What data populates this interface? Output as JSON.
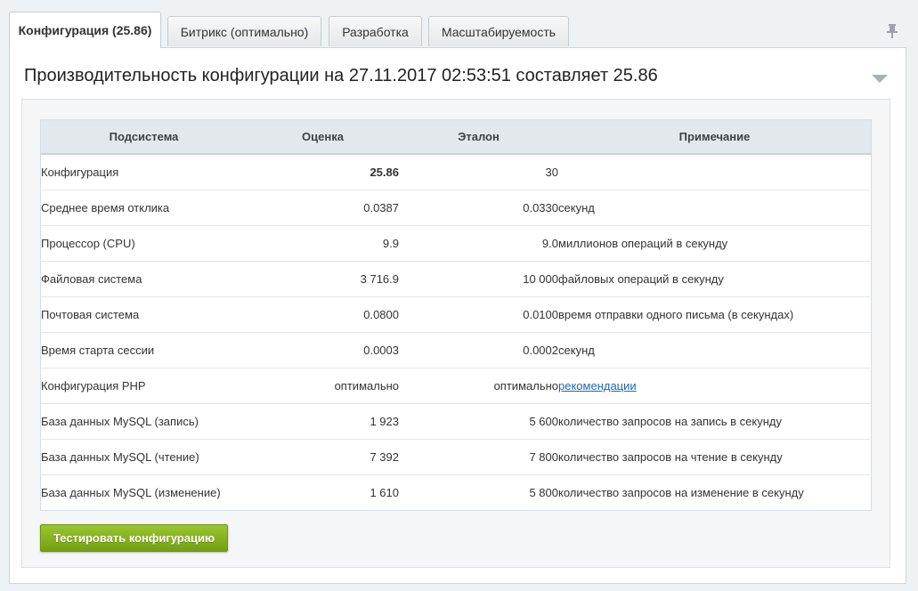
{
  "tabs": [
    {
      "label": "Конфигурация (25.86)",
      "active": true
    },
    {
      "label": "Битрикс (оптимально)",
      "active": false
    },
    {
      "label": "Разработка",
      "active": false
    },
    {
      "label": "Масштабируемость",
      "active": false
    }
  ],
  "icons": {
    "pin": "pin-icon",
    "collapse": "chevron-down-icon"
  },
  "panel": {
    "heading": "Производительность конфигурации на 27.11.2017 02:53:51 составляет 25.86"
  },
  "table": {
    "headers": [
      "Подсистема",
      "Оценка",
      "Эталон",
      "Примечание"
    ],
    "rows": [
      {
        "name": "Конфигурация",
        "score": "25.86",
        "reference": "30",
        "note": ""
      },
      {
        "name": "Среднее время отклика",
        "score": "0.0387",
        "reference": "0.0330",
        "note": "секунд"
      },
      {
        "name": "Процессор (CPU)",
        "score": "9.9",
        "reference": "9.0",
        "note": "миллионов операций в секунду"
      },
      {
        "name": "Файловая система",
        "score": "3 716.9",
        "reference": "10 000",
        "note": "файловых операций в секунду"
      },
      {
        "name": "Почтовая система",
        "score": "0.0800",
        "reference": "0.0100",
        "note": "время отправки одного письма (в секундах)"
      },
      {
        "name": "Время старта сессии",
        "score": "0.0003",
        "reference": "0.0002",
        "note": "секунд"
      },
      {
        "name": "Конфигурация PHP",
        "score": "оптимально",
        "reference": "оптимально",
        "note": "рекомендации",
        "note_is_link": true
      },
      {
        "name": "База данных MySQL (запись)",
        "score": "1 923",
        "reference": "5 600",
        "note": "количество запросов на запись в секунду"
      },
      {
        "name": "База данных MySQL (чтение)",
        "score": "7 392",
        "reference": "7 800",
        "note": "количество запросов на чтение в секунду"
      },
      {
        "name": "База данных MySQL (изменение)",
        "score": "1 610",
        "reference": "5 800",
        "note": "количество запросов на изменение в секунду"
      }
    ]
  },
  "button": {
    "label": "Тестировать конфигурацию"
  },
  "colors": {
    "accent_green": "#7fae1c",
    "link": "#2067b0",
    "header_bg": "#e3e8ec"
  }
}
